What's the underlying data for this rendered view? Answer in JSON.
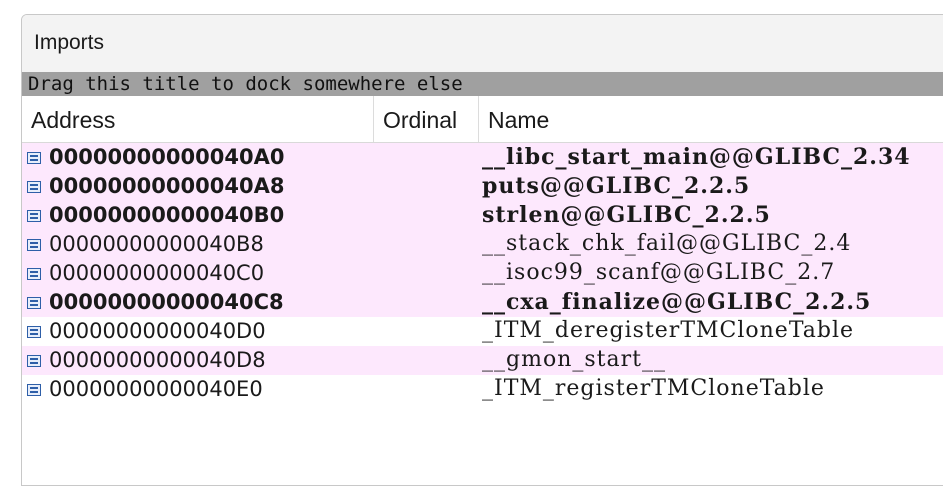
{
  "panel": {
    "title": "Imports"
  },
  "dock_hint": "Drag this title to dock somewhere else",
  "columns": {
    "address": "Address",
    "ordinal": "Ordinal",
    "name": "Name"
  },
  "colors": {
    "highlight": "#fde8fd",
    "dock_bar": "#a0a0a0"
  },
  "rows": [
    {
      "address": "00000000000040A0",
      "name": "__libc_start_main@@GLIBC_2.34",
      "highlight": true,
      "bold": true
    },
    {
      "address": "00000000000040A8",
      "name": "puts@@GLIBC_2.2.5",
      "highlight": true,
      "bold": true
    },
    {
      "address": "00000000000040B0",
      "name": "strlen@@GLIBC_2.2.5",
      "highlight": true,
      "bold": true
    },
    {
      "address": "00000000000040B8",
      "name": "__stack_chk_fail@@GLIBC_2.4",
      "highlight": true,
      "bold": false
    },
    {
      "address": "00000000000040C0",
      "name": "__isoc99_scanf@@GLIBC_2.7",
      "highlight": true,
      "bold": false
    },
    {
      "address": "00000000000040C8",
      "name": "__cxa_finalize@@GLIBC_2.2.5",
      "highlight": true,
      "bold": true
    },
    {
      "address": "00000000000040D0",
      "name": "_ITM_deregisterTMCloneTable",
      "highlight": false,
      "bold": false
    },
    {
      "address": "00000000000040D8",
      "name": "__gmon_start__",
      "highlight": true,
      "bold": false
    },
    {
      "address": "00000000000040E0",
      "name": "_ITM_registerTMCloneTable",
      "highlight": false,
      "bold": false
    }
  ]
}
